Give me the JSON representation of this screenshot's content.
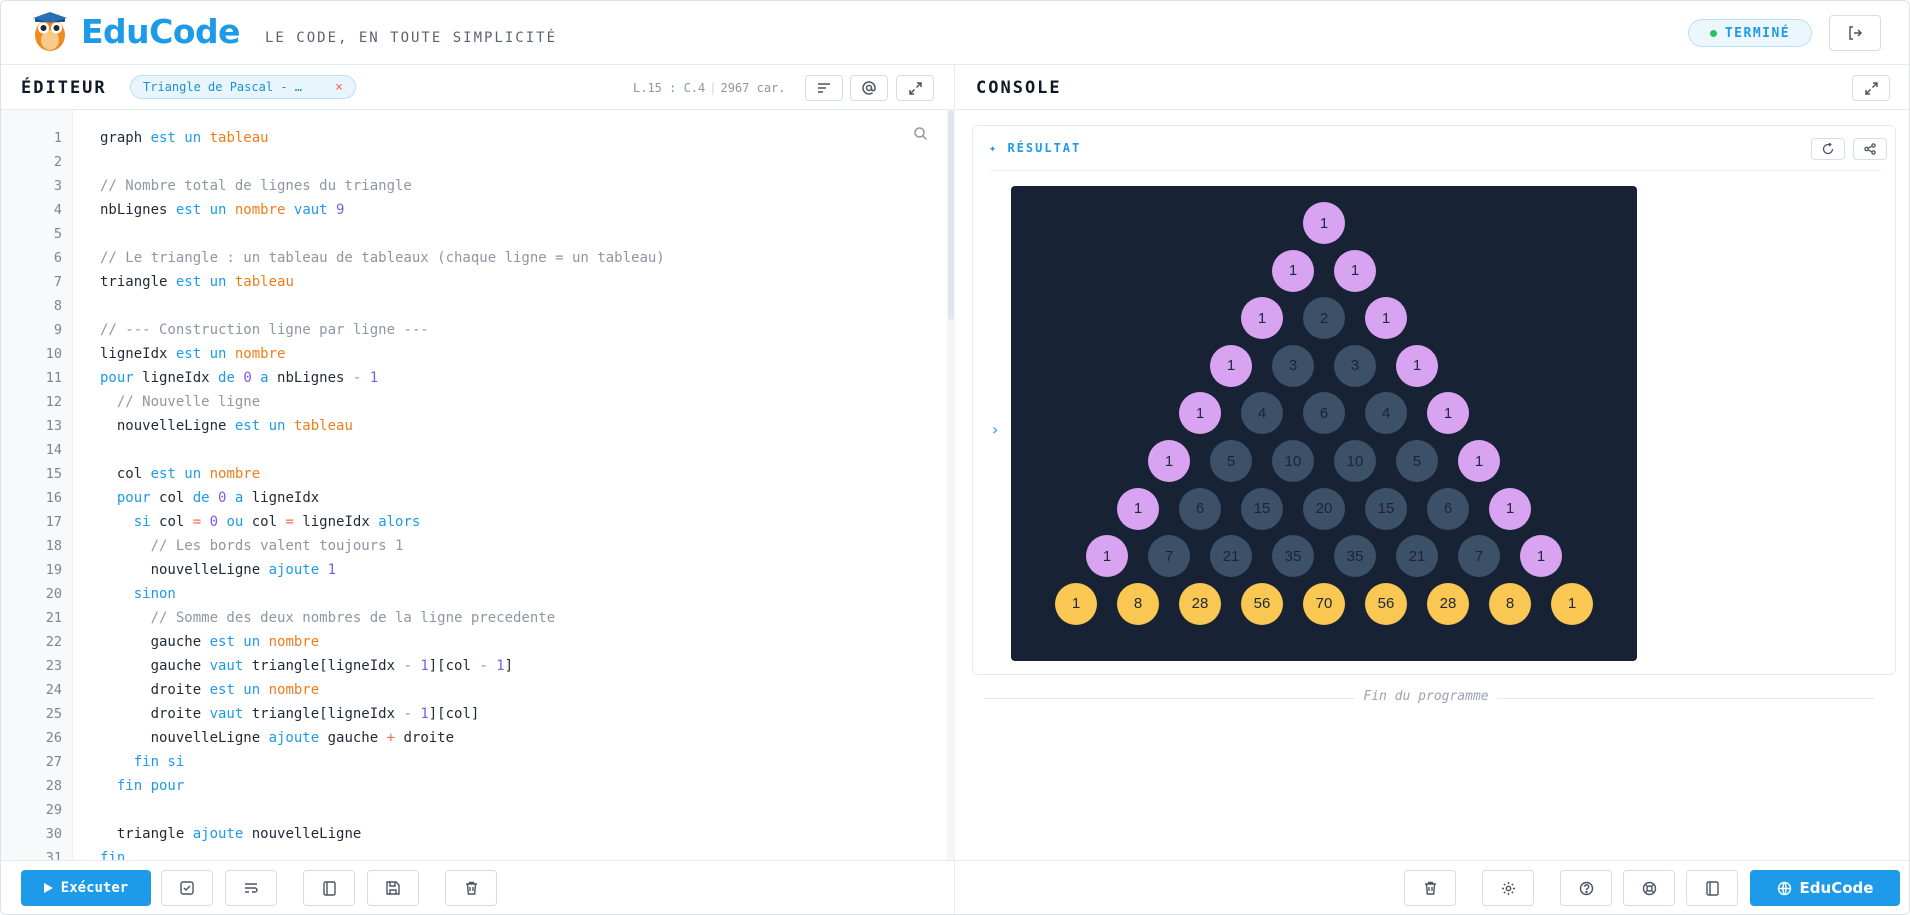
{
  "header": {
    "brand": "EduCode",
    "tagline": "LE CODE, EN TOUTE SIMPLICITÉ",
    "status": "TERMINÉ",
    "logout_icon": "logout-icon"
  },
  "editor": {
    "title": "ÉDITEUR",
    "file_tab": "Triangle de Pascal - …",
    "close_glyph": "×",
    "cursor": "L.15 : C.4",
    "chars": "2967 car.",
    "tools": [
      "format-lines-icon",
      "at-sign-icon",
      "expand-icon"
    ],
    "lines": [
      {
        "n": "1",
        "t": [
          [
            "graph ",
            ""
          ],
          [
            "est un ",
            "kw"
          ],
          [
            "tableau",
            "ty"
          ]
        ]
      },
      {
        "n": "2",
        "t": []
      },
      {
        "n": "3",
        "t": [
          [
            "// Nombre total de lignes du triangle",
            "cm"
          ]
        ]
      },
      {
        "n": "4",
        "t": [
          [
            "nbLignes ",
            ""
          ],
          [
            "est un ",
            "kw"
          ],
          [
            "nombre ",
            "ty"
          ],
          [
            "vaut ",
            "kw"
          ],
          [
            "9",
            "num"
          ]
        ]
      },
      {
        "n": "5",
        "t": []
      },
      {
        "n": "6",
        "t": [
          [
            "// Le triangle : un tableau de tableaux (chaque ligne = un tableau)",
            "cm"
          ]
        ]
      },
      {
        "n": "7",
        "t": [
          [
            "triangle ",
            ""
          ],
          [
            "est un ",
            "kw"
          ],
          [
            "tableau",
            "ty"
          ]
        ]
      },
      {
        "n": "8",
        "t": []
      },
      {
        "n": "9",
        "t": [
          [
            "// --- Construction ligne par ligne ---",
            "cm"
          ]
        ]
      },
      {
        "n": "10",
        "t": [
          [
            "ligneIdx ",
            ""
          ],
          [
            "est un ",
            "kw"
          ],
          [
            "nombre",
            "ty"
          ]
        ]
      },
      {
        "n": "11",
        "t": [
          [
            "pour ",
            "kw"
          ],
          [
            "ligneIdx ",
            ""
          ],
          [
            "de ",
            "kw"
          ],
          [
            "0 ",
            "num"
          ],
          [
            "a ",
            "kw"
          ],
          [
            "nbLignes ",
            ""
          ],
          [
            "- ",
            "op"
          ],
          [
            "1",
            "num"
          ]
        ]
      },
      {
        "n": "12",
        "t": [
          [
            "  // Nouvelle ligne",
            "cm"
          ]
        ]
      },
      {
        "n": "13",
        "t": [
          [
            "  nouvelleLigne ",
            ""
          ],
          [
            "est un ",
            "kw"
          ],
          [
            "tableau",
            "ty"
          ]
        ]
      },
      {
        "n": "14",
        "t": []
      },
      {
        "n": "15",
        "t": [
          [
            "  col ",
            ""
          ],
          [
            "est un ",
            "kw"
          ],
          [
            "nombre",
            "ty"
          ]
        ]
      },
      {
        "n": "16",
        "t": [
          [
            "  pour ",
            "kw"
          ],
          [
            "col ",
            ""
          ],
          [
            "de ",
            "kw"
          ],
          [
            "0 ",
            "num"
          ],
          [
            "a ",
            "kw"
          ],
          [
            "ligneIdx",
            ""
          ]
        ]
      },
      {
        "n": "17",
        "t": [
          [
            "    si ",
            "kw"
          ],
          [
            "col ",
            ""
          ],
          [
            "= ",
            "op"
          ],
          [
            "0 ",
            "num"
          ],
          [
            "ou ",
            "kw"
          ],
          [
            "col ",
            ""
          ],
          [
            "= ",
            "op"
          ],
          [
            "ligneIdx ",
            ""
          ],
          [
            "alors",
            "kw"
          ]
        ]
      },
      {
        "n": "18",
        "t": [
          [
            "      // Les bords valent toujours 1",
            "cm"
          ]
        ]
      },
      {
        "n": "19",
        "t": [
          [
            "      nouvelleLigne ",
            ""
          ],
          [
            "ajoute ",
            "kw"
          ],
          [
            "1",
            "num"
          ]
        ]
      },
      {
        "n": "20",
        "t": [
          [
            "    sinon",
            "kw"
          ]
        ]
      },
      {
        "n": "21",
        "t": [
          [
            "      // Somme des deux nombres de la ligne precedente",
            "cm"
          ]
        ]
      },
      {
        "n": "22",
        "t": [
          [
            "      gauche ",
            ""
          ],
          [
            "est un ",
            "kw"
          ],
          [
            "nombre",
            "ty"
          ]
        ]
      },
      {
        "n": "23",
        "t": [
          [
            "      gauche ",
            ""
          ],
          [
            "vaut ",
            "kw"
          ],
          [
            "triangle[ligneIdx ",
            ""
          ],
          [
            "- ",
            "op"
          ],
          [
            "1",
            "num"
          ],
          [
            "][col ",
            ""
          ],
          [
            "- ",
            "op"
          ],
          [
            "1",
            "num"
          ],
          [
            "]",
            ""
          ]
        ]
      },
      {
        "n": "24",
        "t": [
          [
            "      droite ",
            ""
          ],
          [
            "est un ",
            "kw"
          ],
          [
            "nombre",
            "ty"
          ]
        ]
      },
      {
        "n": "25",
        "t": [
          [
            "      droite ",
            ""
          ],
          [
            "vaut ",
            "kw"
          ],
          [
            "triangle[ligneIdx ",
            ""
          ],
          [
            "- ",
            "op"
          ],
          [
            "1",
            "num"
          ],
          [
            "][col]",
            ""
          ]
        ]
      },
      {
        "n": "26",
        "t": [
          [
            "      nouvelleLigne ",
            ""
          ],
          [
            "ajoute ",
            "kw"
          ],
          [
            "gauche ",
            ""
          ],
          [
            "+ ",
            "op"
          ],
          [
            "droite",
            ""
          ]
        ]
      },
      {
        "n": "27",
        "t": [
          [
            "    fin si",
            "kw"
          ]
        ]
      },
      {
        "n": "28",
        "t": [
          [
            "  fin pour",
            "kw"
          ]
        ]
      },
      {
        "n": "29",
        "t": []
      },
      {
        "n": "30",
        "t": [
          [
            "  triangle ",
            ""
          ],
          [
            "ajoute ",
            "kw"
          ],
          [
            "nouvelleLigne",
            ""
          ]
        ]
      },
      {
        "n": "31",
        "t": [
          [
            "fin",
            "kw"
          ]
        ]
      }
    ]
  },
  "editor_footer": {
    "run_label": "Exécuter",
    "buttons": [
      "check-square-icon",
      "wrap-text-icon",
      "book-icon",
      "save-icon",
      "trash-icon"
    ]
  },
  "console": {
    "title": "CONSOLE",
    "result_label": "✦ RÉSULTAT",
    "end_text": "Fin du programme",
    "triangle": [
      [
        "1"
      ],
      [
        "1",
        "1"
      ],
      [
        "1",
        "2",
        "1"
      ],
      [
        "1",
        "3",
        "3",
        "1"
      ],
      [
        "1",
        "4",
        "6",
        "4",
        "1"
      ],
      [
        "1",
        "5",
        "10",
        "10",
        "5",
        "1"
      ],
      [
        "1",
        "6",
        "15",
        "20",
        "15",
        "6",
        "1"
      ],
      [
        "1",
        "7",
        "21",
        "35",
        "35",
        "21",
        "7",
        "1"
      ],
      [
        "1",
        "8",
        "28",
        "56",
        "70",
        "56",
        "28",
        "8",
        "1"
      ]
    ],
    "colors": {
      "edge": "#d8a4f2",
      "inner": "#3c5068",
      "last_row": "#f9c752",
      "canvas": "#172234"
    }
  },
  "console_footer": {
    "buttons": [
      "trash-icon",
      "settings-icon",
      "help-icon",
      "lifebuoy-icon",
      "book-icon"
    ],
    "brand_label": "EduCode"
  }
}
